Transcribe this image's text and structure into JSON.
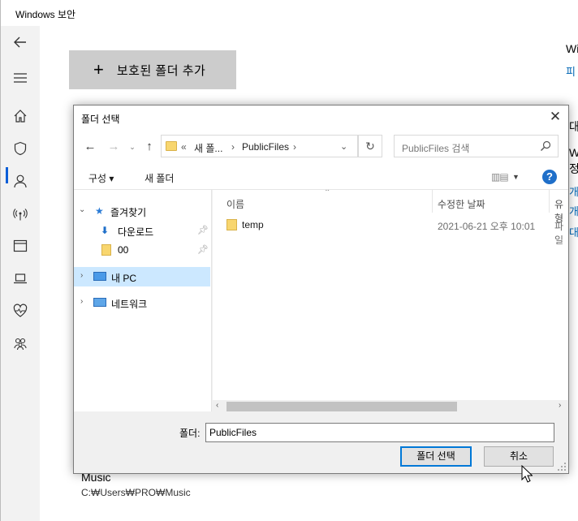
{
  "outer": {
    "title": "Windows 보안",
    "add_folder_label": "보호된 폴더 추가",
    "right_edge_texts": [
      "Win",
      "피",
      "대",
      "Wi",
      "정",
      "개",
      "개",
      "대"
    ],
    "music_title": "Music",
    "music_path": "C:₩Users₩PRO₩Music"
  },
  "dialog": {
    "title": "폴더 선택",
    "address_prefix": "«",
    "address_crumb_1": "새 폴...",
    "address_crumb_sep": "›",
    "address_crumb_2": "PublicFiles",
    "address_crumb_sep_2": "›",
    "search_placeholder": "PublicFiles 검색",
    "toolbar_organize": "구성 ▾",
    "toolbar_new_folder": "새 폴더",
    "help": "?",
    "nav_tree": {
      "favorites": "즐겨찾기",
      "downloads": "다운로드",
      "folder_00": "00",
      "this_pc": "내 PC",
      "network": "네트워크"
    },
    "columns": {
      "name": "이름",
      "date": "수정한 날짜",
      "type": "유형"
    },
    "files": [
      {
        "name": "temp",
        "date": "2021-06-21 오후 10:01",
        "type": "파일"
      }
    ],
    "folder_label": "폴더:",
    "folder_value": "PublicFiles",
    "select_button": "폴더 선택",
    "cancel_button": "취소"
  }
}
